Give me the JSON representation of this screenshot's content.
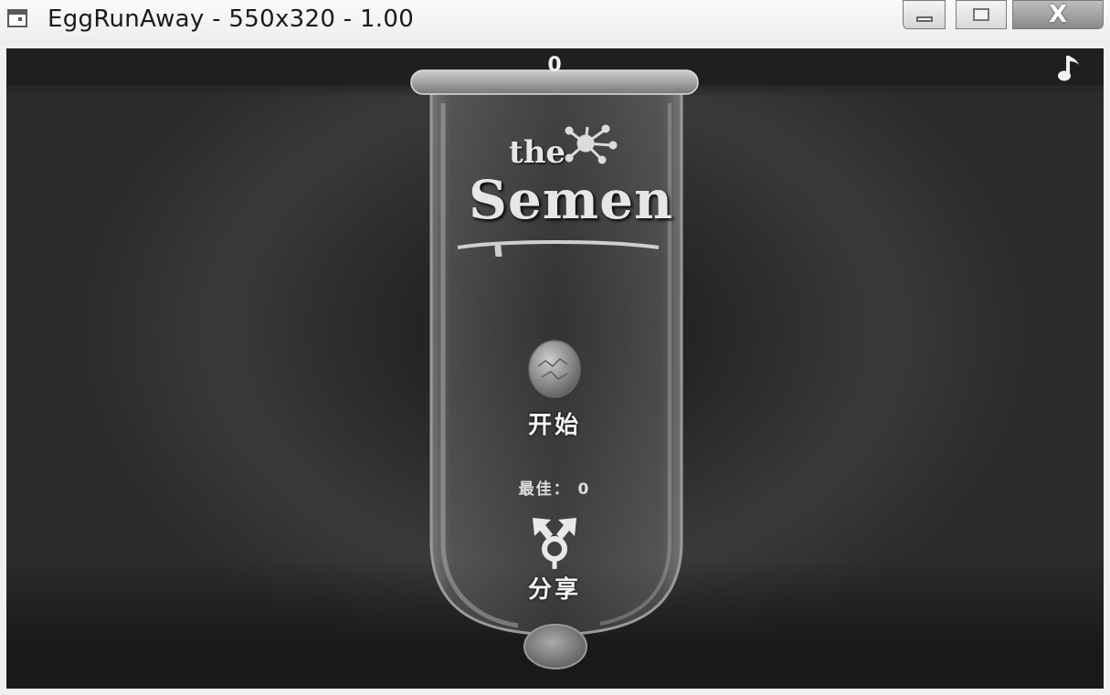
{
  "window": {
    "title": "EggRunAway - 550x320 - 1.00",
    "close_glyph": "X"
  },
  "game": {
    "score": "0",
    "logo_text_small": "the",
    "logo_text_big": "Semen",
    "start_label": "开始",
    "best_label": "最佳： 0",
    "share_label": "分享",
    "icons": {
      "music": "music-note-icon",
      "egg": "egg-icon",
      "share": "share-arrows-icon",
      "logo_splat": "splat-icon"
    }
  },
  "colors": {
    "background": "#2b2b2b",
    "topbar": "#1f1f1f",
    "text": "#f2f2f2"
  }
}
